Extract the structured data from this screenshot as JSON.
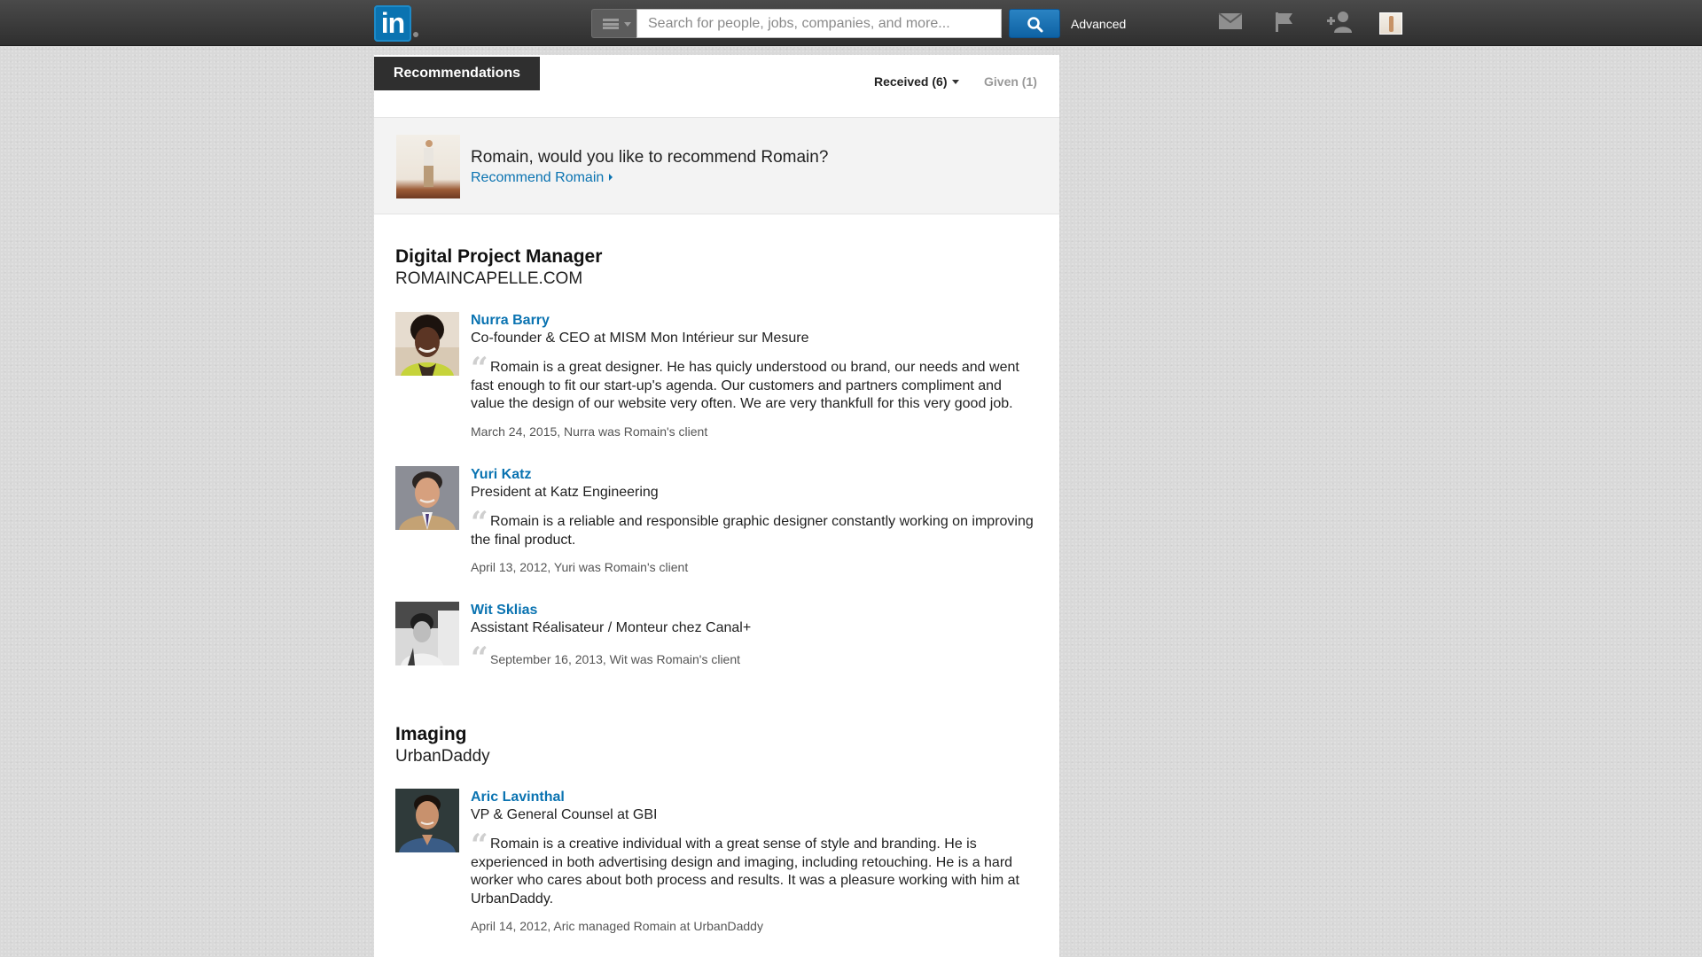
{
  "topbar": {
    "logo_text": "in",
    "search_placeholder": "Search for people, jobs, companies, and more...",
    "advanced_label": "Advanced",
    "icons": [
      "menu-icon",
      "search-icon",
      "mail-icon",
      "flag-icon",
      "add-connection-icon",
      "profile-avatar"
    ],
    "brand_color": "#0a73b1"
  },
  "tabs": {
    "active": "Recommendations",
    "received": "Received (6)",
    "given": "Given (1)"
  },
  "prompt": {
    "question": "Romain, would you like to recommend Romain?",
    "link": "Recommend Romain"
  },
  "sections": [
    {
      "title": "Digital Project Manager",
      "company": "ROMAINCAPELLE.COM",
      "recommendations": [
        {
          "name": "Nurra Barry",
          "headline": "Co-founder & CEO at MISM Mon Intérieur sur Mesure",
          "text": "Romain is a great designer. He has quicly understood ou brand, our needs and went fast enough to fit our start-up's agenda. Our customers and partners compliment and value the design of our website very often. We are very thankfull for this very good job.",
          "meta": "March 24, 2015, Nurra was Romain's client"
        },
        {
          "name": "Yuri Katz",
          "headline": "President at Katz Engineering",
          "text": "Romain is a reliable and responsible graphic designer constantly working on improving the final product.",
          "meta": "April 13, 2012, Yuri was Romain's client"
        },
        {
          "name": "Wit Sklias",
          "headline": "Assistant Réalisateur / Monteur chez Canal+",
          "text": "",
          "meta": "September 16, 2013, Wit was Romain's client"
        }
      ]
    },
    {
      "title": "Imaging",
      "company": "UrbanDaddy",
      "recommendations": [
        {
          "name": "Aric Lavinthal",
          "headline": "VP & General Counsel at GBI",
          "text": "Romain is a creative individual with a great sense of style and branding. He is experienced in both advertising design and imaging, including retouching. He is a hard worker who cares about both process and results. It was a pleasure working with him at UrbanDaddy.",
          "meta": "April 14, 2012, Aric managed Romain at UrbanDaddy"
        }
      ]
    }
  ]
}
